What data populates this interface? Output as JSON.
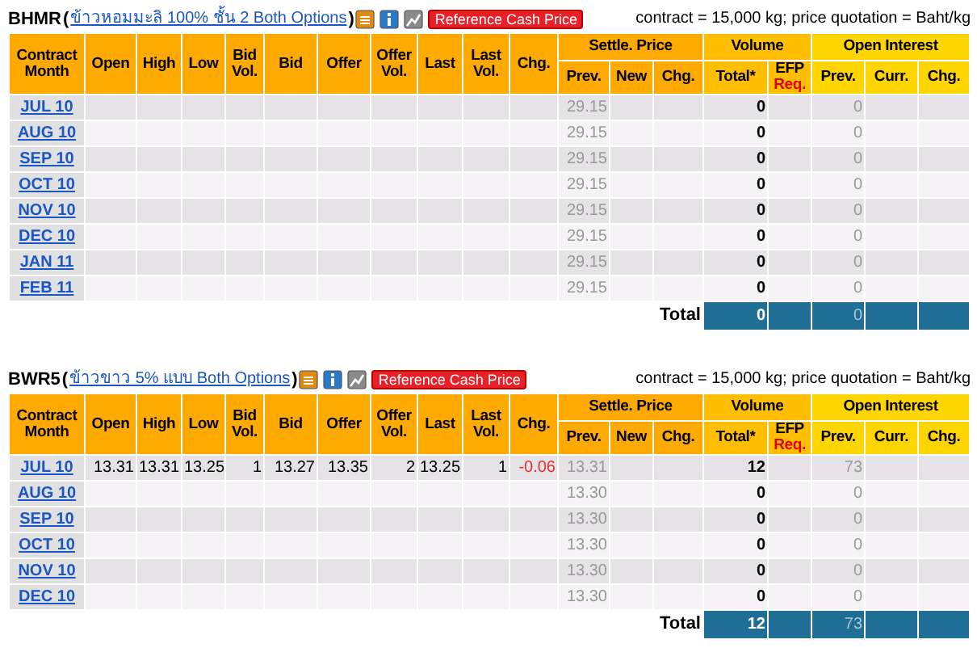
{
  "sections": [
    {
      "symbol": "BHMR",
      "paren_open": "(",
      "description": "ข้าวหอมมะลิ 100% ชั้น 2 Both Options",
      "paren_close": ")",
      "button": "Reference Cash Price",
      "note": "contract = 15,000 kg; price quotation = Baht/kg",
      "single_columns": [
        "Contract Month",
        "Open",
        "High",
        "Low",
        "Bid Vol.",
        "Bid",
        "Offer",
        "Offer Vol.",
        "Last",
        "Last Vol.",
        "Chg."
      ],
      "groups": [
        {
          "label": "Settle. Price",
          "color": "#ffaa00",
          "columns": [
            {
              "label": "Prev."
            },
            {
              "label": "New"
            },
            {
              "label": "Chg."
            }
          ]
        },
        {
          "label": "Volume",
          "color": "#ffbf00",
          "columns": [
            {
              "label": "Total*"
            },
            {
              "label": "EFP",
              "note": "Req."
            }
          ]
        },
        {
          "label": "Open Interest",
          "color": "#ffd500",
          "columns": [
            {
              "label": "Prev."
            },
            {
              "label": "Curr."
            },
            {
              "label": "Chg."
            }
          ]
        }
      ],
      "rows": [
        {
          "month": "JUL 10",
          "settle_prev": "29.15",
          "volume_total": "0",
          "oi_prev": "0"
        },
        {
          "month": "AUG 10",
          "settle_prev": "29.15",
          "volume_total": "0",
          "oi_prev": "0"
        },
        {
          "month": "SEP 10",
          "settle_prev": "29.15",
          "volume_total": "0",
          "oi_prev": "0"
        },
        {
          "month": "OCT 10",
          "settle_prev": "29.15",
          "volume_total": "0",
          "oi_prev": "0"
        },
        {
          "month": "NOV 10",
          "settle_prev": "29.15",
          "volume_total": "0",
          "oi_prev": "0"
        },
        {
          "month": "DEC 10",
          "settle_prev": "29.15",
          "volume_total": "0",
          "oi_prev": "0"
        },
        {
          "month": "JAN 11",
          "settle_prev": "29.15",
          "volume_total": "0",
          "oi_prev": "0"
        },
        {
          "month": "FEB 11",
          "settle_prev": "29.15",
          "volume_total": "0",
          "oi_prev": "0"
        }
      ],
      "total": {
        "label": "Total",
        "volume_total": "0",
        "oi_prev": "0"
      }
    },
    {
      "symbol": "BWR5",
      "paren_open": "(",
      "description": "ข้าวขาว 5% แบบ Both Options",
      "paren_close": ")",
      "button": "Reference Cash Price",
      "note": "contract = 15,000 kg; price quotation = Baht/kg",
      "single_columns": [
        "Contract Month",
        "Open",
        "High",
        "Low",
        "Bid Vol.",
        "Bid",
        "Offer",
        "Offer Vol.",
        "Last",
        "Last Vol.",
        "Chg."
      ],
      "groups": [
        {
          "label": "Settle. Price",
          "color": "#ffaa00",
          "columns": [
            {
              "label": "Prev."
            },
            {
              "label": "New"
            },
            {
              "label": "Chg."
            }
          ]
        },
        {
          "label": "Volume",
          "color": "#ffbf00",
          "columns": [
            {
              "label": "Total*"
            },
            {
              "label": "EFP",
              "note": "Req."
            }
          ]
        },
        {
          "label": "Open Interest",
          "color": "#ffd500",
          "columns": [
            {
              "label": "Prev."
            },
            {
              "label": "Curr."
            },
            {
              "label": "Chg."
            }
          ]
        }
      ],
      "rows": [
        {
          "month": "JUL 10",
          "open": "13.31",
          "high": "13.31",
          "low": "13.25",
          "bid_vol": "1",
          "bid": "13.27",
          "offer": "13.35",
          "offer_vol": "2",
          "last": "13.25",
          "last_vol": "1",
          "chg": "-0.06",
          "chg_down": true,
          "settle_prev": "13.31",
          "volume_total": "12",
          "oi_prev": "73"
        },
        {
          "month": "AUG 10",
          "settle_prev": "13.30",
          "volume_total": "0",
          "oi_prev": "0"
        },
        {
          "month": "SEP 10",
          "settle_prev": "13.30",
          "volume_total": "0",
          "oi_prev": "0"
        },
        {
          "month": "OCT 10",
          "settle_prev": "13.30",
          "volume_total": "0",
          "oi_prev": "0"
        },
        {
          "month": "NOV 10",
          "settle_prev": "13.30",
          "volume_total": "0",
          "oi_prev": "0"
        },
        {
          "month": "DEC 10",
          "settle_prev": "13.30",
          "volume_total": "0",
          "oi_prev": "0"
        }
      ],
      "total": {
        "label": "Total",
        "volume_total": "12",
        "oi_prev": "73"
      }
    }
  ]
}
